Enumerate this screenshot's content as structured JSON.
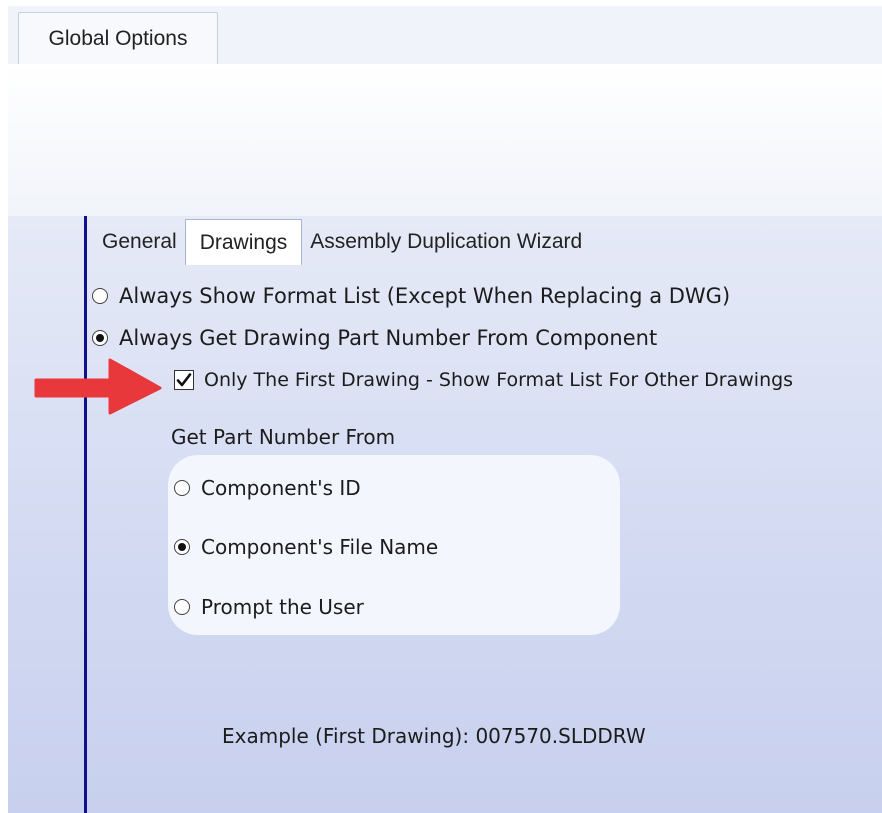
{
  "window": {
    "tab_label": "Global Options"
  },
  "inner_tabs": [
    {
      "label": "General",
      "active": false
    },
    {
      "label": "Drawings",
      "active": true
    },
    {
      "label": "Assembly Duplication Wizard",
      "active": false
    }
  ],
  "options": {
    "format_list": {
      "label": "Always Show Format List (Except When Replacing a DWG)",
      "selected": false
    },
    "from_component": {
      "label": "Always Get Drawing Part Number From Component",
      "selected": true
    },
    "first_only": {
      "label": "Only The First Drawing - Show Format List For Other Drawings",
      "checked": true
    }
  },
  "part_number": {
    "group_label": "Get Part Number From",
    "choices": [
      {
        "label": "Component's ID",
        "selected": false
      },
      {
        "label": "Component's File Name",
        "selected": true
      },
      {
        "label": "Prompt the User",
        "selected": false
      }
    ]
  },
  "example": "Example (First Drawing): 007570.SLDDRW",
  "colors": {
    "accent_line": "#10108c",
    "arrow": "#e8383b",
    "panel_top": "#e6eaf7",
    "panel_bottom": "#c7d0ee"
  },
  "icons": {
    "annotation": "arrow-right-icon",
    "checkmark": "checkmark-icon"
  }
}
